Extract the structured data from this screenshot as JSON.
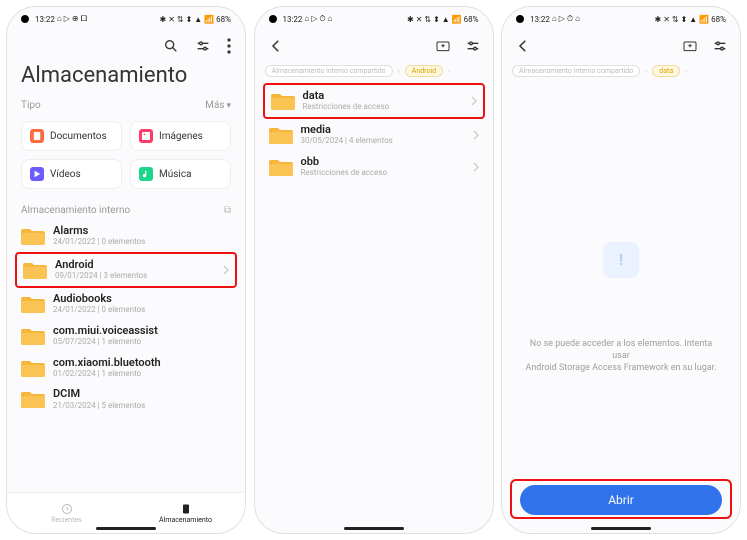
{
  "status": {
    "time": "13:22",
    "left_extra": "⌂ ▷ ⊕ 🞑",
    "left_extra_alt": "⌂ ▷ ⏱ ⌂",
    "right": "✱ ✕ ⇅ ⬍ ▲ 📶 68%"
  },
  "p1": {
    "title": "Almacenamiento",
    "type_label": "Tipo",
    "type_more": "Más",
    "types": [
      {
        "label": "Documentos"
      },
      {
        "label": "Imágenes"
      },
      {
        "label": "Vídeos"
      },
      {
        "label": "Música"
      }
    ],
    "storage_label": "Almacenamiento interno",
    "folders": [
      {
        "name": "Alarms",
        "meta": "24/01/2022  |  0 elementos"
      },
      {
        "name": "Android",
        "meta": "09/01/2024  |  3 elementos",
        "hl": true,
        "chev": true
      },
      {
        "name": "Audiobooks",
        "meta": "24/01/2022  |  0 elementos"
      },
      {
        "name": "com.miui.voiceassist",
        "meta": "05/07/2024  |  1 elemento"
      },
      {
        "name": "com.xiaomi.bluetooth",
        "meta": "01/02/2024  |  1 elemento"
      },
      {
        "name": "DCIM",
        "meta": "21/03/2024  |  5 elementos"
      }
    ],
    "tabs": [
      {
        "label": "Recientes"
      },
      {
        "label": "Almacenamiento"
      }
    ]
  },
  "p2": {
    "crumbs": [
      {
        "label": "Almacenamiento interno compartido",
        "on": false
      },
      {
        "label": "Android",
        "on": true
      }
    ],
    "folders": [
      {
        "name": "data",
        "meta": "Restricciones de acceso",
        "hl": true,
        "chev": true
      },
      {
        "name": "media",
        "meta": "30/05/2024  |  4 elementos",
        "chev": true
      },
      {
        "name": "obb",
        "meta": "Restricciones de acceso",
        "chev": true
      }
    ]
  },
  "p3": {
    "crumbs": [
      {
        "label": "Almacenamiento interno compartido",
        "on": false
      },
      {
        "label": "data",
        "on": true
      }
    ],
    "empty_l1": "No se puede acceder a los elementos. Intenta usar",
    "empty_l2": "Android Storage Access Framework en su lugar.",
    "button": "Abrir"
  }
}
